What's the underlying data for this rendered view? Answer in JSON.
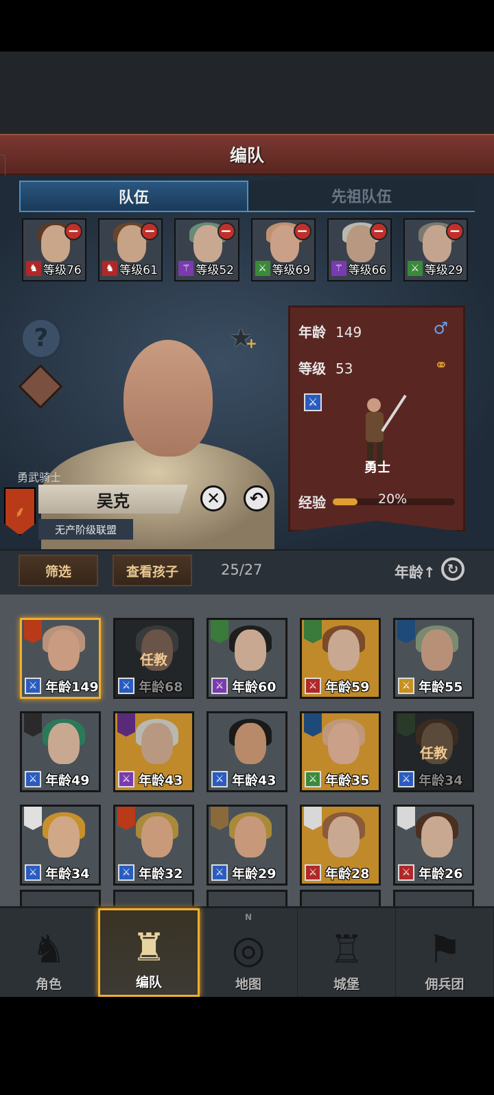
{
  "title": "编队",
  "tabs": [
    {
      "label": "队伍"
    },
    {
      "label": "先祖队伍"
    }
  ],
  "team": [
    {
      "level": "等级76",
      "class": "horse-icon",
      "class_color": "#b02828",
      "hair": "#5a3a24",
      "skin": "#c9a58a"
    },
    {
      "level": "等级61",
      "class": "horse-icon",
      "class_color": "#b02828",
      "hair": "#6a4428",
      "skin": "#c6a286"
    },
    {
      "level": "等级52",
      "class": "staff-icon",
      "class_color": "#7a3ab0",
      "hair": "#6a8a78",
      "skin": "#c8a890"
    },
    {
      "level": "等级69",
      "class": "crossed-swords-icon",
      "class_color": "#3a8a3a",
      "hair": "#c09070",
      "skin": "#caa088"
    },
    {
      "level": "等级66",
      "class": "staff-icon",
      "class_color": "#7a3ab0",
      "hair": "#b8b8b0",
      "skin": "#b89880"
    },
    {
      "level": "等级29",
      "class": "crossed-swords-icon",
      "class_color": "#3a8a3a",
      "hair": "#7a7a70",
      "skin": "#c4a48e"
    }
  ],
  "hero": {
    "title": "勇武骑士",
    "name": "吴克",
    "alliance": "无产阶级联盟",
    "age_label": "年龄",
    "age": "149",
    "level_label": "等级",
    "level": "53",
    "gender_icon": "male-icon",
    "married_icon": "rings-icon",
    "unit_class": "勇士",
    "exp_label": "经验",
    "exp_percent": "20%",
    "exp_fraction": 0.2
  },
  "filter": {
    "filter_label": "筛选",
    "children_label": "查看孩子",
    "count": "25/27",
    "sort_label": "年龄↑"
  },
  "roster": [
    {
      "age": "年龄149",
      "class_color": "#2a5cc0",
      "banner": "#b83a18",
      "hair": "#b8927a",
      "skin": "#c99b80",
      "bg": "#4a5258",
      "selected": true
    },
    {
      "age": "年龄68",
      "class_color": "#2a5cc0",
      "banner": "",
      "hair": "#3a3a3a",
      "skin": "#6a5448",
      "bg": "#232628",
      "dim": true,
      "duty": "任教"
    },
    {
      "age": "年龄60",
      "class_color": "#7a3ab0",
      "banner": "#3a7a3a",
      "hair": "#1e1e1e",
      "skin": "#c8a890",
      "bg": "#4a5258"
    },
    {
      "age": "年龄59",
      "class_color": "#b02828",
      "banner": "#3a7a3a",
      "hair": "#7a4a2a",
      "skin": "#c8a890",
      "bg": "#c08a2a"
    },
    {
      "age": "年龄55",
      "class_color": "#c89020",
      "banner": "#1e4a7a",
      "hair": "#7a8a70",
      "skin": "#b89078",
      "bg": "#4a5258"
    },
    {
      "age": "年龄49",
      "class_color": "#2a5cc0",
      "banner": "#2a2a2a",
      "hair": "#2a7a5a",
      "skin": "#c8a890",
      "bg": "#4a5258"
    },
    {
      "age": "年龄43",
      "class_color": "#7a3ab0",
      "banner": "#5a2a7a",
      "hair": "#b8b8b0",
      "skin": "#b89880",
      "bg": "#c08a2a"
    },
    {
      "age": "年龄43",
      "class_color": "#2a5cc0",
      "banner": "",
      "hair": "#1a1a1a",
      "skin": "#b88a6a",
      "bg": "#4a5258"
    },
    {
      "age": "年龄35",
      "class_color": "#3a8a3a",
      "banner": "#1e4a7a",
      "hair": "#c09878",
      "skin": "#caa088",
      "bg": "#c08a2a"
    },
    {
      "age": "年龄34",
      "class_color": "#2a5cc0",
      "banner": "#2a3a2a",
      "hair": "#3a2a20",
      "skin": "#5a4a3a",
      "bg": "#232628",
      "dim": true,
      "duty": "任教"
    },
    {
      "age": "年龄34",
      "class_color": "#2a5cc0",
      "banner": "#e0e0e0",
      "hair": "#c8902a",
      "skin": "#d0a888",
      "bg": "#4a5258"
    },
    {
      "age": "年龄32",
      "class_color": "#2a5cc0",
      "banner": "#b83a18",
      "hair": "#a88a3a",
      "skin": "#c89a7a",
      "bg": "#4a5258"
    },
    {
      "age": "年龄29",
      "class_color": "#2a5cc0",
      "banner": "#8a6a3a",
      "hair": "#a88a3a",
      "skin": "#c8987a",
      "bg": "#4a5258"
    },
    {
      "age": "年龄28",
      "class_color": "#b02828",
      "banner": "#d8d8d8",
      "hair": "#8a5a3a",
      "skin": "#c8a890",
      "bg": "#c08a2a"
    },
    {
      "age": "年龄26",
      "class_color": "#b02828",
      "banner": "#d8d8d8",
      "hair": "#4a3020",
      "skin": "#c8a890",
      "bg": "#4a5258"
    }
  ],
  "nav": [
    {
      "label": "角色",
      "icon": "knight-icon"
    },
    {
      "label": "编队",
      "icon": "helmet-icon",
      "active": true
    },
    {
      "label": "地图",
      "icon": "compass-map-icon",
      "north": "N"
    },
    {
      "label": "城堡",
      "icon": "castle-icon"
    },
    {
      "label": "佣兵团",
      "icon": "mercenary-banner-icon"
    }
  ]
}
